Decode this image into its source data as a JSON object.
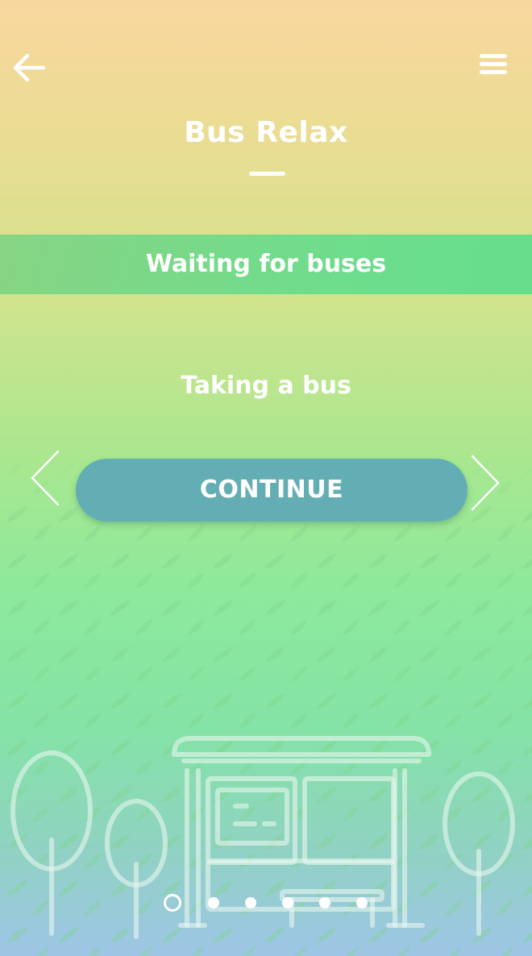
{
  "header": {
    "back_icon": "arrow-left-icon",
    "menu_icon": "hamburger-menu-icon",
    "app_title": "Bus Relax"
  },
  "section": {
    "title": "Waiting for buses"
  },
  "content": {
    "subtitle": "Taking a bus",
    "continue_label": "CONTINUE",
    "prev_icon": "chevron-left-icon",
    "next_icon": "chevron-right-icon"
  },
  "pager": {
    "total_pages": 6,
    "current_page": 1
  },
  "colors": {
    "gradient_top": "#f9d79f",
    "gradient_middle": "#a9e78f",
    "gradient_bottom": "#9ec5e6",
    "section_band": "#64de8c",
    "button": "#63aeb4",
    "text": "#ffffff"
  }
}
